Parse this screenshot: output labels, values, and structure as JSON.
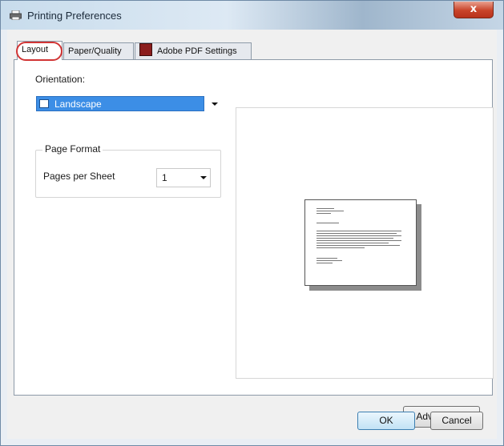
{
  "window": {
    "title": "Printing Preferences",
    "close_glyph": "x"
  },
  "tabs": [
    {
      "label": "Layout",
      "active": true
    },
    {
      "label": "Paper/Quality",
      "active": false
    },
    {
      "label": "Adobe PDF Settings",
      "active": false,
      "icon": "adobe-pdf-icon"
    }
  ],
  "layout": {
    "orientation_label": "Orientation:",
    "orientation_value": "Landscape",
    "page_format_title": "Page Format",
    "pages_per_sheet_label": "Pages per Sheet",
    "pages_per_sheet_value": "1"
  },
  "buttons": {
    "advanced": "Advanced...",
    "ok": "OK",
    "cancel": "Cancel"
  },
  "colors": {
    "selection": "#3c8ee6",
    "highlight_circle": "#d13535",
    "close_button": "#c9442a"
  }
}
